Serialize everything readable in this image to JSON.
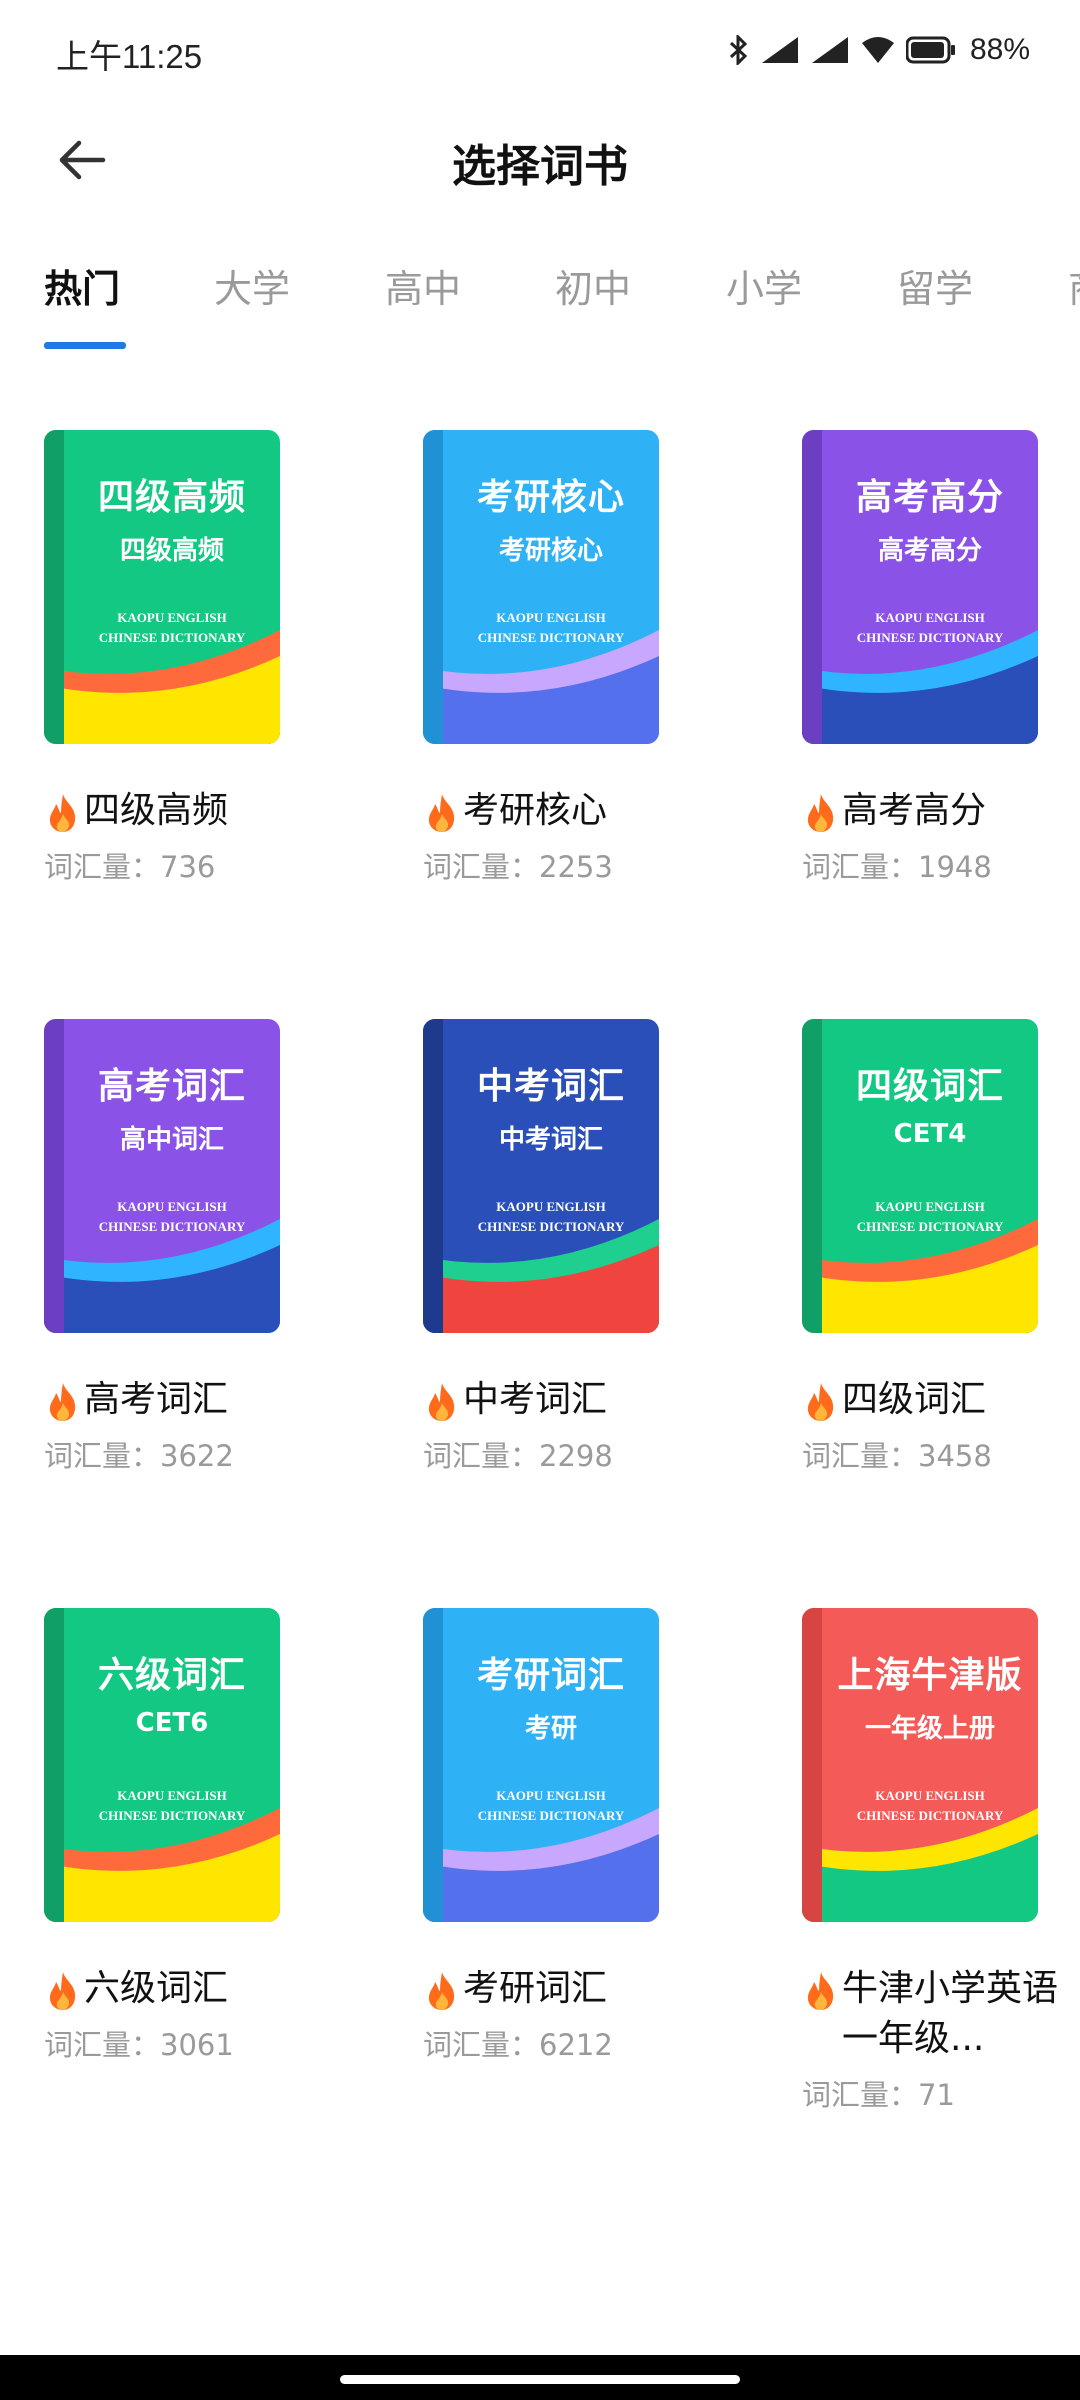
{
  "status_bar": {
    "time": "上午11:25",
    "battery": "88%"
  },
  "header": {
    "title": "选择词书"
  },
  "tabs": [
    {
      "label": "热门",
      "active": true
    },
    {
      "label": "大学",
      "active": false
    },
    {
      "label": "高中",
      "active": false
    },
    {
      "label": "初中",
      "active": false
    },
    {
      "label": "小学",
      "active": false
    },
    {
      "label": "留学",
      "active": false
    },
    {
      "label": "商",
      "active": false
    }
  ],
  "cover_brand": {
    "line1": "KAOPU ENGLISH",
    "line2": "CHINESE DICTIONARY"
  },
  "books": [
    {
      "cover_title": "四级高频",
      "cover_subtitle": "四级高频",
      "name": "四级高频",
      "count": "词汇量：736",
      "colors": {
        "bg": "#13c883",
        "spine": "#0f9f67",
        "wave1": "#ff6a3d",
        "wave2": "#ffe600"
      }
    },
    {
      "cover_title": "考研核心",
      "cover_subtitle": "考研核心",
      "name": "考研核心",
      "count": "词汇量：2253",
      "colors": {
        "bg": "#2eb1f5",
        "spine": "#2191d6",
        "wave1": "#c8a8ff",
        "wave2": "#5470ec"
      }
    },
    {
      "cover_title": "高考高分",
      "cover_subtitle": "高考高分",
      "name": "高考高分",
      "count": "词汇量：1948",
      "colors": {
        "bg": "#8a52e6",
        "spine": "#6c3ec2",
        "wave1": "#2fb5ff",
        "wave2": "#2a4fb8"
      }
    },
    {
      "cover_title": "高考词汇",
      "cover_subtitle": "高中词汇",
      "name": "高考词汇",
      "count": "词汇量：3622",
      "colors": {
        "bg": "#8a52e6",
        "spine": "#6c3ec2",
        "wave1": "#2fb5ff",
        "wave2": "#2a4fb8"
      }
    },
    {
      "cover_title": "中考词汇",
      "cover_subtitle": "中考词汇",
      "name": "中考词汇",
      "count": "词汇量：2298",
      "colors": {
        "bg": "#2a4fb8",
        "spine": "#1e3a8c",
        "wave1": "#1fcf8f",
        "wave2": "#f0453f"
      }
    },
    {
      "cover_title": "四级词汇",
      "cover_subtitle": "CET4",
      "name": "四级词汇",
      "count": "词汇量：3458",
      "colors": {
        "bg": "#13c883",
        "spine": "#0f9f67",
        "wave1": "#ff6a3d",
        "wave2": "#ffe600"
      }
    },
    {
      "cover_title": "六级词汇",
      "cover_subtitle": "CET6",
      "name": "六级词汇",
      "count": "词汇量：3061",
      "colors": {
        "bg": "#13c883",
        "spine": "#0f9f67",
        "wave1": "#ff6a3d",
        "wave2": "#ffe600"
      }
    },
    {
      "cover_title": "考研词汇",
      "cover_subtitle": "考研",
      "name": "考研词汇",
      "count": "词汇量：6212",
      "colors": {
        "bg": "#2eb1f5",
        "spine": "#2191d6",
        "wave1": "#c8a8ff",
        "wave2": "#5470ec"
      }
    },
    {
      "cover_title": "上海牛津版",
      "cover_subtitle": "一年级上册",
      "name": "牛津小学英语一年级...",
      "count": "词汇量：71",
      "colors": {
        "bg": "#f45a57",
        "spine": "#d64542",
        "wave1": "#ffe600",
        "wave2": "#13c883"
      }
    }
  ],
  "icons": {
    "back": "arrow-left-icon",
    "hot": "fire-icon"
  },
  "colors": {
    "accent": "#1e7ae6",
    "muted_text": "#9a9a9a"
  }
}
